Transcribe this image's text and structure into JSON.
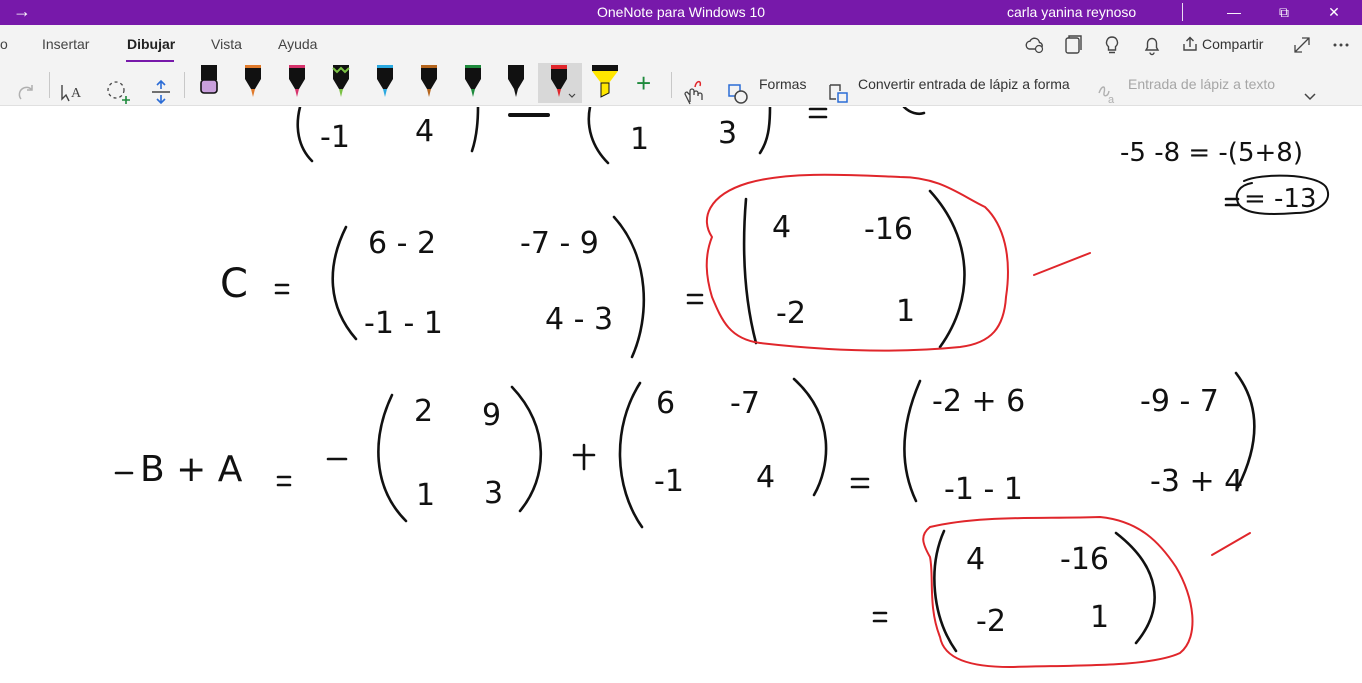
{
  "titlebar": {
    "title": "OneNote para Windows 10",
    "user": "carla yanina reynoso",
    "back_glyph": "→",
    "min_glyph": "—",
    "restore_glyph": "⧉",
    "close_glyph": "✕",
    "color": "#7719aa"
  },
  "tabs": [
    {
      "label": "o"
    },
    {
      "label": "Insertar"
    },
    {
      "label": "Dibujar"
    },
    {
      "label": "Vista"
    },
    {
      "label": "Ayuda"
    }
  ],
  "active_tab": "Dibujar",
  "ribbon_right": {
    "share_label": "Compartir",
    "icons": [
      "cloud-sync-icon",
      "pages-icon",
      "lightbulb-icon",
      "bell-icon",
      "share-icon",
      "expand-icon",
      "more-icon"
    ]
  },
  "toolbar": {
    "shapes_label": "Formas",
    "convert_ink_label": "Convertir entrada de lápiz a forma",
    "ink_to_text_label": "Entrada de lápiz a texto",
    "pens": [
      {
        "name": "black-pen",
        "color": "#111111",
        "tip": "#c9a0dc"
      },
      {
        "name": "black-pen-2",
        "color": "#111111",
        "tip": "#e07a2b"
      },
      {
        "name": "black-pen-3",
        "color": "#111111",
        "tip": "#d6336c"
      },
      {
        "name": "black-pen-4",
        "color": "#111111",
        "tip": "#7ac143"
      },
      {
        "name": "black-pen-5",
        "color": "#111111",
        "tip": "#2ba9e0"
      },
      {
        "name": "black-pen-6",
        "color": "#111111",
        "tip": "#b5651d"
      },
      {
        "name": "black-pen-7",
        "color": "#111111",
        "tip": "#1e8a3c"
      },
      {
        "name": "black-pen-8",
        "color": "#111111",
        "tip": "#111111"
      },
      {
        "name": "red-pen",
        "color": "#111111",
        "tip": "#e0262b"
      },
      {
        "name": "highlighter",
        "color": "#ffe600",
        "tip": "#ffe600"
      }
    ],
    "add_pen_glyph": "+"
  },
  "ink": {
    "top_row_left": [
      "-1",
      "4"
    ],
    "top_row_right": [
      "1",
      "3"
    ],
    "side_note": [
      "-5 -8 = -(5+8)",
      "= -13"
    ],
    "c_label": "C =",
    "c_matrix": [
      [
        "6 - 2",
        "-7 - 9"
      ],
      [
        "-1 - 1",
        "4 - 3"
      ]
    ],
    "c_result": [
      [
        "4",
        "-16"
      ],
      [
        "-2",
        "1"
      ]
    ],
    "bta_label": "-B + A",
    "b_matrix": [
      [
        "2",
        "9"
      ],
      [
        "1",
        "3"
      ]
    ],
    "a_matrix": [
      [
        "6",
        "-7"
      ],
      [
        "-1",
        "4"
      ]
    ],
    "bta_expanded": [
      [
        "-2 + 6",
        "-9 - 7"
      ],
      [
        "-1 - 1",
        "-3 + 4"
      ]
    ],
    "bta_result": [
      [
        "4",
        "-16"
      ],
      [
        "-2",
        "1"
      ]
    ],
    "equals": "=",
    "minus": "-",
    "plus": "+"
  }
}
